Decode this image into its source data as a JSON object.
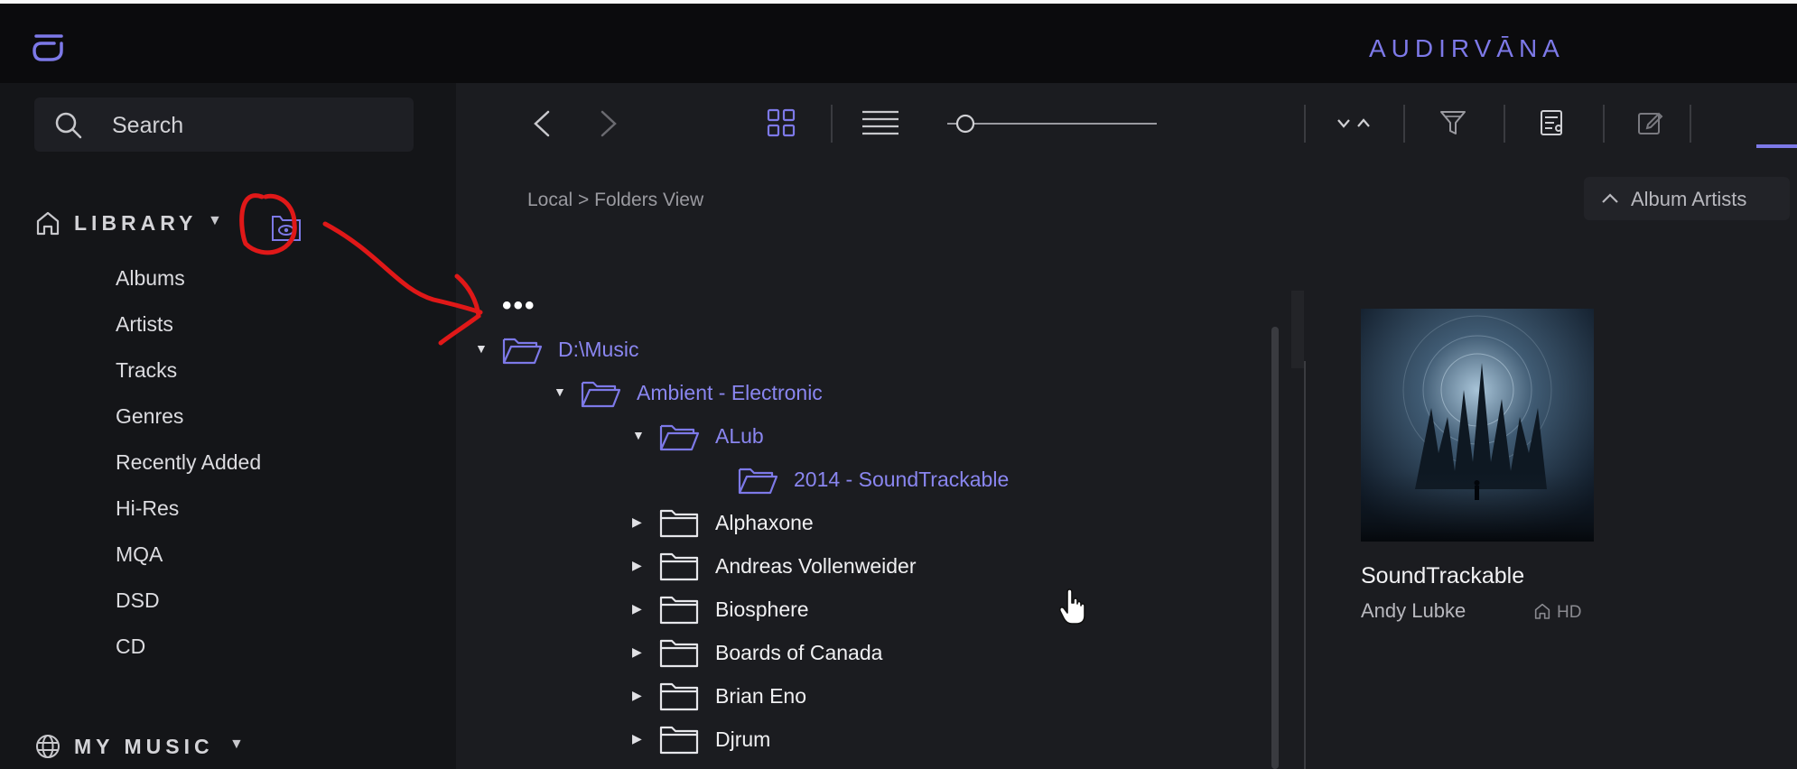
{
  "app": {
    "brand": "AUDIRVĀNA",
    "accent": "#7d79e8"
  },
  "search": {
    "placeholder": "Search"
  },
  "sidebar": {
    "library_label": "LIBRARY",
    "items": [
      "Albums",
      "Artists",
      "Tracks",
      "Genres",
      "Recently Added",
      "Hi-Res",
      "MQA",
      "DSD",
      "CD"
    ],
    "my_music_label": "MY MUSIC"
  },
  "breadcrumb": "Local > Folders View",
  "sort": {
    "label": "Album Artists"
  },
  "tree": {
    "ellipsis": "•••",
    "rows": [
      {
        "name": "D:\\Music",
        "expanded": true,
        "depth": 0
      },
      {
        "name": "Ambient - Electronic",
        "expanded": true,
        "depth": 1
      },
      {
        "name": "ALub",
        "expanded": true,
        "depth": 2
      },
      {
        "name": "2014 - SoundTrackable",
        "expanded": false,
        "depth": 3
      },
      {
        "name": "Alphaxone",
        "expanded": false,
        "depth": 2
      },
      {
        "name": "Andreas Vollenweider",
        "expanded": false,
        "depth": 2
      },
      {
        "name": "Biosphere",
        "expanded": false,
        "depth": 2
      },
      {
        "name": "Boards of Canada",
        "expanded": false,
        "depth": 2
      },
      {
        "name": "Brian Eno",
        "expanded": false,
        "depth": 2
      },
      {
        "name": "Djrum",
        "expanded": false,
        "depth": 2
      }
    ]
  },
  "album": {
    "title": "SoundTrackable",
    "artist": "Andy Lubke",
    "quality": "HD"
  }
}
